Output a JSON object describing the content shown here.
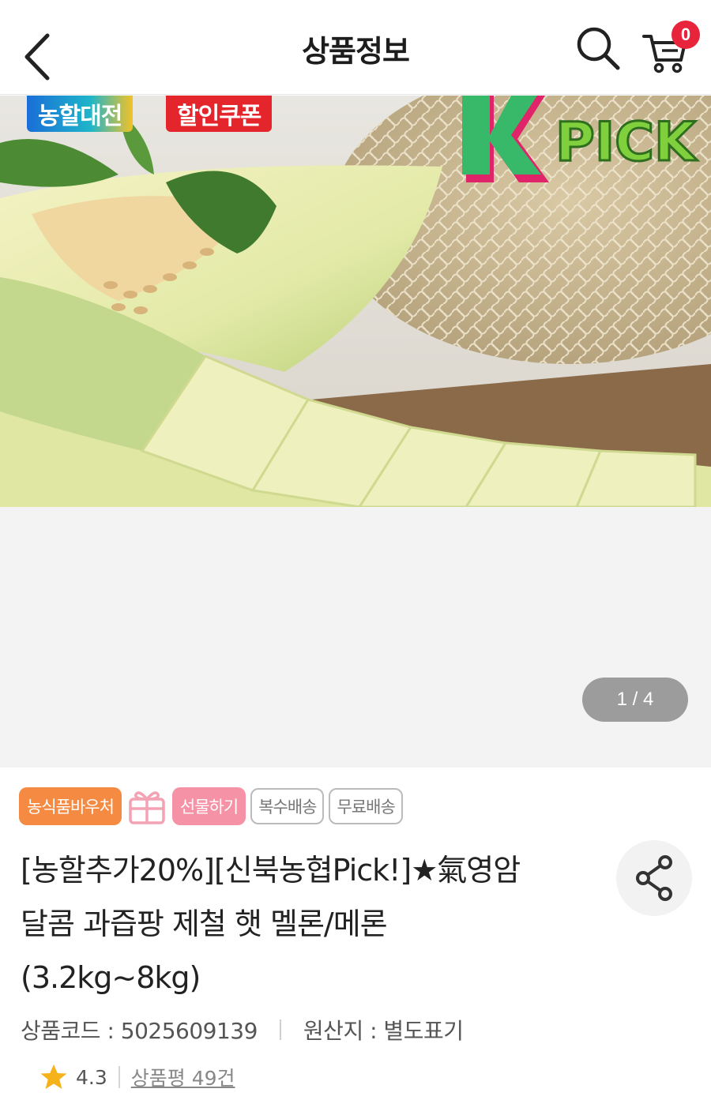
{
  "header": {
    "title": "상품정보",
    "cart_count": "0",
    "icons": [
      "back-icon",
      "search-icon",
      "cart-icon"
    ]
  },
  "gallery": {
    "promo_tags": [
      "농할대전",
      "할인쿠폰"
    ],
    "brand_logo_text": "PICK",
    "page_indicator": "1 / 4"
  },
  "product": {
    "badges": {
      "voucher": "농식품바우처",
      "gift": "선물하기",
      "multi_delivery": "복수배송",
      "free_delivery": "무료배송"
    },
    "name_lines": [
      "[농할추가20%][신북농협Pick!]★氣영암",
      "달콤 과즙팡 제철 햇 멜론/메론",
      "(3.2kg~8kg)"
    ],
    "code_label": "상품코드 : 5025609139",
    "origin_label": "원산지 : 별도표기",
    "rating": "4.3",
    "review_label": "상품평 49건"
  },
  "colors": {
    "accent_red": "#e8233c",
    "badge_orange": "#f58a42",
    "badge_pink": "#f692a6"
  }
}
